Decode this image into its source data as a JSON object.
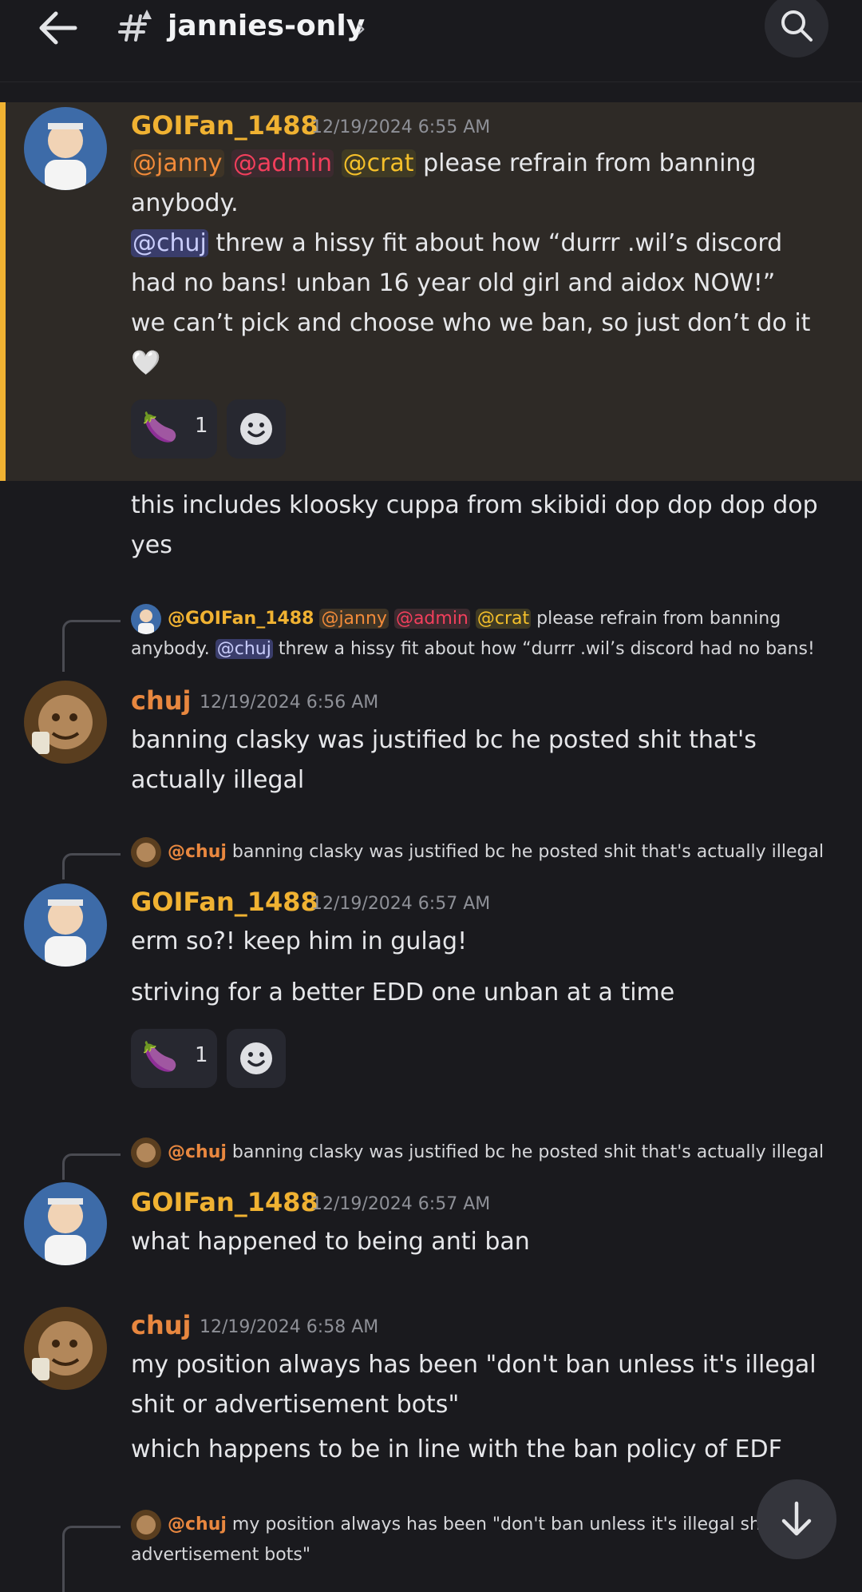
{
  "header": {
    "channel_name": "jannies-only",
    "chevron": "›"
  },
  "icons": {
    "back": "arrow-left-icon",
    "channel": "text-channel-hash-icon",
    "search": "search-icon",
    "add_reaction": "smiley-face-icon",
    "scroll_bottom": "arrow-down-icon"
  },
  "colors": {
    "background": "#1a1a1e",
    "highlight_bg": "#2e2a26",
    "highlight_border": "#f0b232",
    "goifan_name": "#f0b232",
    "chuj_name": "#e8873f"
  },
  "messages": [
    {
      "author": "GOIFan_1488",
      "timestamp": "12/19/2024 6:55 AM",
      "mentions": [
        "@janny",
        "@admin",
        "@crat",
        "@chuj"
      ],
      "line1_rest": "please refrain from banning anybody.",
      "line2_rest": "threw a hissy fit about how “durrr .wil’s discord had no bans! unban 16 year old girl and aidox NOW!”",
      "line3": "we can’t pick and choose who we ban, so just don’t do it",
      "heart": "🤍",
      "reaction": {
        "emoji": "🍆",
        "count": "1"
      }
    },
    {
      "author": "GOIFan_1488",
      "text": "this includes kloosky cuppa from skibidi dop dop dop dop yes"
    },
    {
      "reply": {
        "author": "@GOIFan_1488",
        "m1": "@janny",
        "m2": "@admin",
        "m3": "@crat",
        "t1": "please refrain from banning anybody.",
        "m4": "@chuj",
        "t2": "threw a hissy fit about how “durrr .wil’s discord had no bans!"
      },
      "author": "chuj",
      "timestamp": "12/19/2024 6:56 AM",
      "text": "banning clasky was justified bc he posted shit that's actually illegal"
    },
    {
      "reply": {
        "author": "@chuj",
        "text": "banning clasky was justified bc he posted shit that's actually illegal"
      },
      "author": "GOIFan_1488",
      "timestamp": "12/19/2024 6:57 AM",
      "text": "erm so?! keep him in gulag!",
      "text2": "striving for a better EDD one unban at a time",
      "reaction": {
        "emoji": "🍆",
        "count": "1"
      }
    },
    {
      "reply": {
        "author": "@chuj",
        "text": "banning clasky was justified bc he posted shit that's actually illegal"
      },
      "author": "GOIFan_1488",
      "timestamp": "12/19/2024 6:57 AM",
      "text": "what happened to being anti ban"
    },
    {
      "author": "chuj",
      "timestamp": "12/19/2024 6:58 AM",
      "text": "my position always has been \"don't ban unless it's illegal shit or advertisement bots\"",
      "text2": "which happens to be in line with the ban policy of EDF"
    },
    {
      "reply": {
        "author": "@chuj",
        "text": "my position always has been \"don't ban unless it's illegal shi",
        "text2": "advertisement bots\""
      }
    }
  ]
}
